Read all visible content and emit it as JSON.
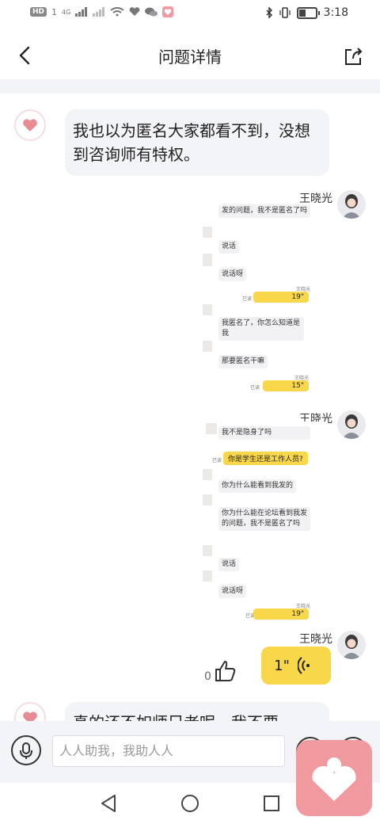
{
  "status_bar": {
    "left_badges": [
      "HD",
      "1",
      "4G"
    ],
    "time": "3:18"
  },
  "header": {
    "title": "问题详情"
  },
  "comment1": {
    "text": "我也以为匿名大家都看不到，没想到咨询师有特权。"
  },
  "reply1": {
    "author": "王晓光",
    "screenshot": {
      "lines": [
        "发的问题，我不是匿名了吗",
        "说话",
        "说话呀",
        "我匿名了，你怎么知道是我",
        "那要匿名干嘛"
      ],
      "voice_a": "19\"",
      "voice_b": "15\"",
      "read_label": "已读",
      "mini_name": "王晓光"
    }
  },
  "reply2": {
    "author": "王晓光",
    "screenshot": {
      "lines": [
        "我不是隐身了吗",
        "你是学生还是工作人员?",
        "你为什么能看到我发的",
        "你为什么能在论坛看到我发的问题，我不是匿名了吗",
        "说话",
        "说话呀"
      ],
      "voice": "19\"",
      "read_label": "已读",
      "mini_name": "王晓光"
    }
  },
  "reply3": {
    "author": "王晓光",
    "voice_duration": "1\"",
    "like_count": "0"
  },
  "comment2": {
    "text": "真的还不如师兄老呢，我不要"
  },
  "input_bar": {
    "placeholder": "人人助我，我助人人"
  },
  "colors": {
    "accent_yellow": "#f8d74a",
    "brand_pink": "#f09aa0",
    "bubble_gray": "#f3f4f7"
  }
}
